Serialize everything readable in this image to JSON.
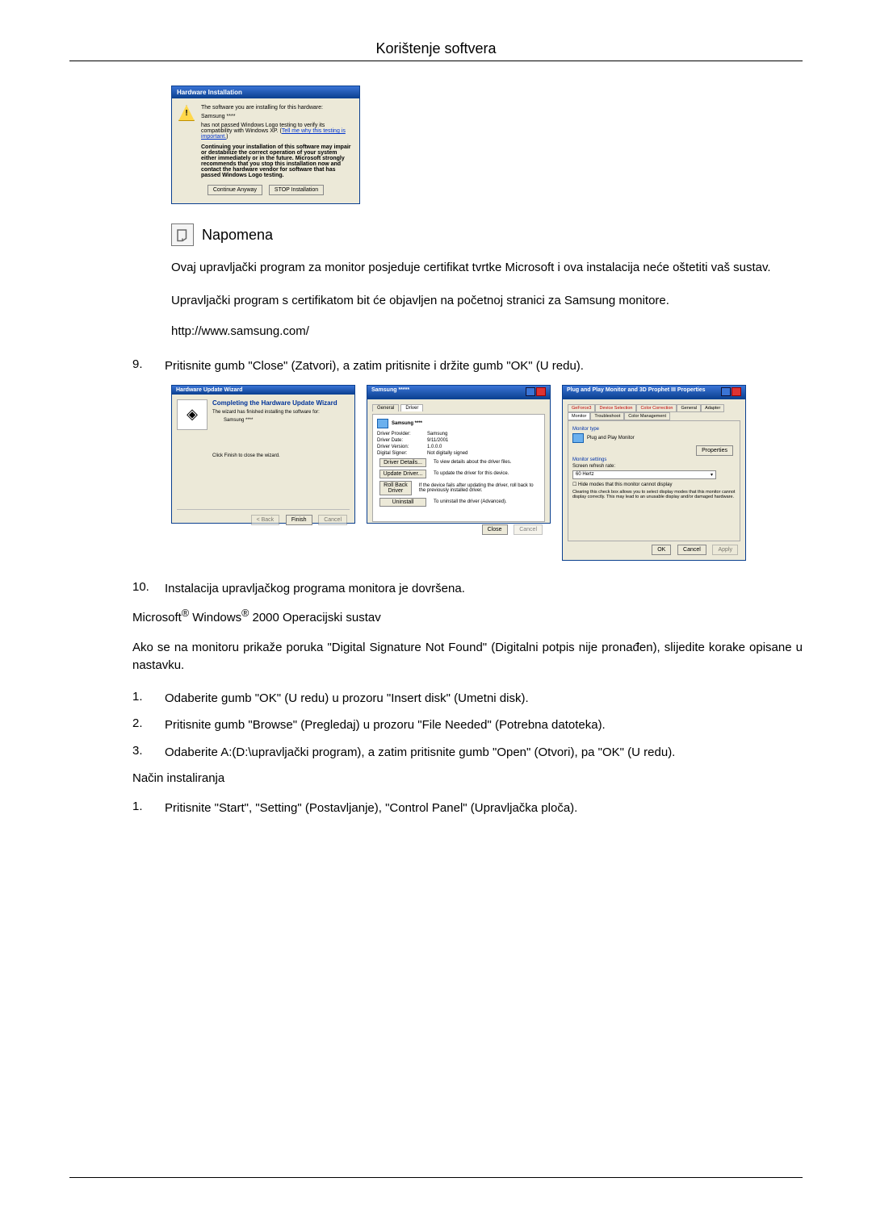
{
  "header": {
    "title": "Korištenje softvera"
  },
  "dialog1": {
    "title": "Hardware Installation",
    "line1": "The software you are installing for this hardware:",
    "device": "Samsung ****",
    "line2a": "has not passed Windows Logo testing to verify its compatibility with Windows XP. (",
    "link": "Tell me why this testing is important.",
    "line2b": ")",
    "bold": "Continuing your installation of this software may impair or destabilize the correct operation of your system either immediately or in the future. Microsoft strongly recommends that you stop this installation now and contact the hardware vendor for software that has passed Windows Logo testing.",
    "btn_continue": "Continue Anyway",
    "btn_stop": "STOP Installation"
  },
  "note": {
    "label": "Napomena"
  },
  "para1": "Ovaj upravljački program za monitor posjeduje certifikat tvrtke Microsoft i ova instalacija neće oštetiti vaš sustav.",
  "para2": "Upravljački program s certifikatom bit će objavljen na početnoj stranici za Samsung monitore.",
  "url": "http://www.samsung.com/",
  "step9": {
    "num": "9.",
    "text": "Pritisnite gumb \"Close\" (Zatvori), a zatim pritisnite i držite gumb \"OK\" (U redu)."
  },
  "wizard": {
    "title": "Hardware Update Wizard",
    "heading": "Completing the Hardware Update Wizard",
    "line1": "The wizard has finished installing the software for:",
    "device": "Samsung ****",
    "line2": "Click Finish to close the wizard.",
    "btn_back": "< Back",
    "btn_finish": "Finish",
    "btn_cancel": "Cancel"
  },
  "driver": {
    "title": "Samsung *****",
    "tab_general": "General",
    "tab_driver": "Driver",
    "device": "Samsung ****",
    "kv": {
      "provider_k": "Driver Provider:",
      "provider_v": "Samsung",
      "date_k": "Driver Date:",
      "date_v": "9/11/2001",
      "version_k": "Driver Version:",
      "version_v": "1.0.0.0",
      "signer_k": "Digital Signer:",
      "signer_v": "Not digitally signed"
    },
    "btns": {
      "details": "Driver Details...",
      "details_t": "To view details about the driver files.",
      "update": "Update Driver...",
      "update_t": "To update the driver for this device.",
      "rollback": "Roll Back Driver",
      "rollback_t": "If the device fails after updating the driver, roll back to the previously installed driver.",
      "uninstall": "Uninstall",
      "uninstall_t": "To uninstall the driver (Advanced)."
    },
    "btn_close": "Close",
    "btn_cancel": "Cancel"
  },
  "props": {
    "title": "Plug and Play Monitor and 3D Prophet III Properties",
    "tabs": {
      "geforce": "GeForce3",
      "devsel": "Device Selection",
      "colcor": "Color Correction",
      "general": "General",
      "adapter": "Adapter",
      "monitor": "Monitor",
      "trouble": "Troubleshoot",
      "colmgmt": "Color Management"
    },
    "grp_type": "Monitor type",
    "monitor_name": "Plug and Play Monitor",
    "btn_props": "Properties",
    "grp_settings": "Monitor settings",
    "refresh_label": "Screen refresh rate:",
    "refresh_value": "60 Hertz",
    "chk": "Hide modes that this monitor cannot display",
    "note": "Clearing this check box allows you to select display modes that this monitor cannot display correctly. This may lead to an unusable display and/or damaged hardware.",
    "btn_ok": "OK",
    "btn_cancel": "Cancel",
    "btn_apply": "Apply"
  },
  "step10": {
    "num": "10.",
    "text": "Instalacija upravljačkog programa monitora je dovršena."
  },
  "os_line": {
    "prefix": "Microsoft",
    "r1": "®",
    "mid": " Windows",
    "r2": "®",
    "suffix": " 2000 Operacijski sustav"
  },
  "para3": "Ako se na monitoru prikaže poruka \"Digital Signature Not Found\" (Digitalni potpis nije pronađen), slijedite korake opisane u nastavku.",
  "w2k": {
    "s1n": "1.",
    "s1": "Odaberite gumb \"OK\" (U redu) u prozoru \"Insert disk\" (Umetni disk).",
    "s2n": "2.",
    "s2": "Pritisnite gumb \"Browse\" (Pregledaj) u prozoru \"File Needed\" (Potrebna datoteka).",
    "s3n": "3.",
    "s3": "Odaberite A:(D:\\upravljački program), a zatim pritisnite gumb \"Open\" (Otvori), pa \"OK\" (U redu)."
  },
  "install_heading": "Način instaliranja",
  "inst": {
    "s1n": "1.",
    "s1": "Pritisnite \"Start\", \"Setting\" (Postavljanje), \"Control Panel\" (Upravljačka ploča)."
  }
}
